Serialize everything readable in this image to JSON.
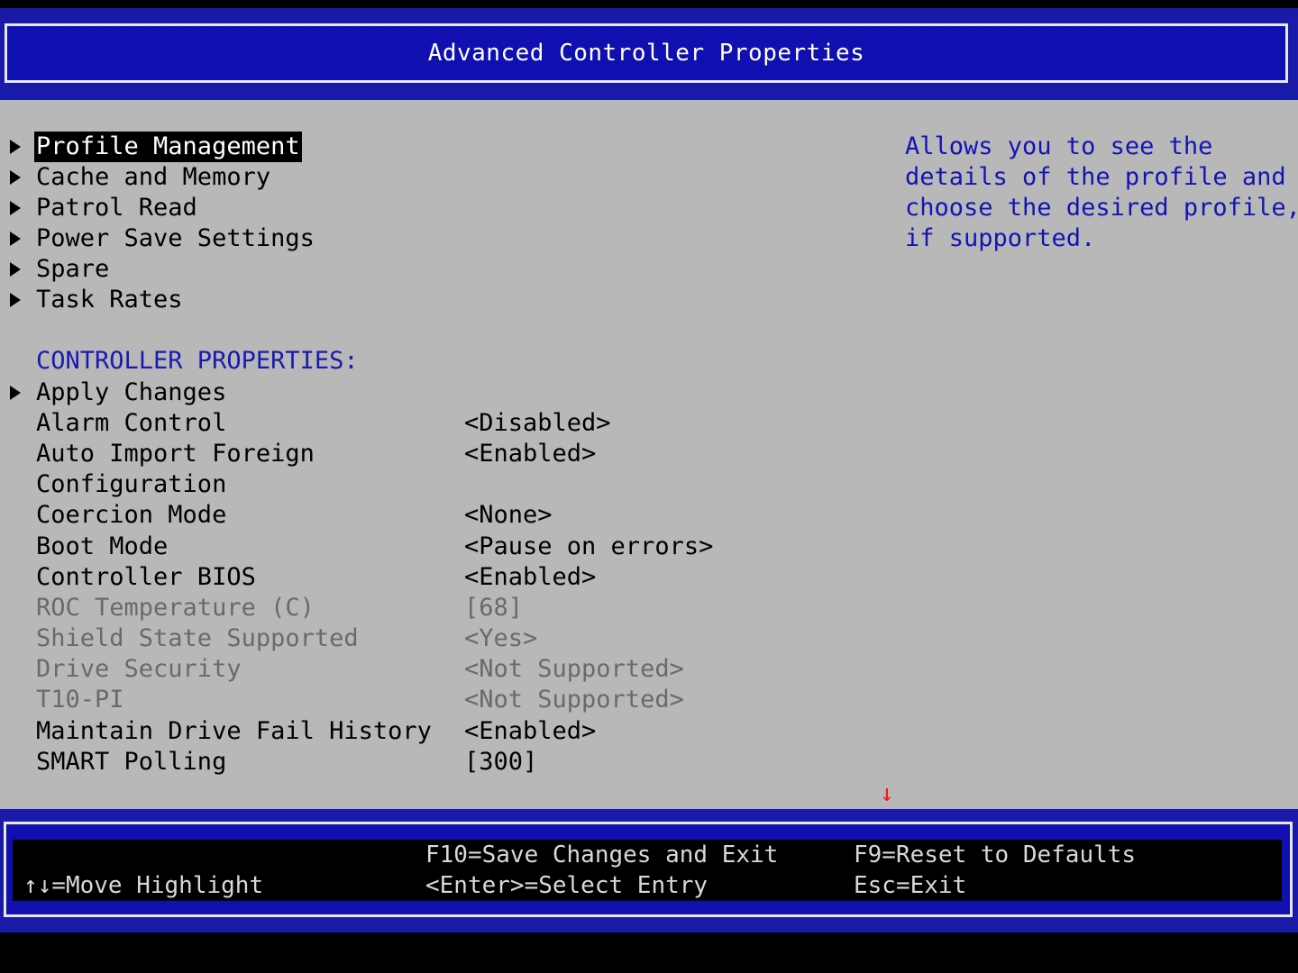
{
  "header": {
    "title": "Advanced Controller Properties"
  },
  "menu": {
    "items": [
      {
        "label": "Profile Management",
        "selected": true
      },
      {
        "label": "Cache and Memory"
      },
      {
        "label": "Patrol Read"
      },
      {
        "label": "Power Save Settings"
      },
      {
        "label": "Spare"
      },
      {
        "label": "Task Rates"
      }
    ]
  },
  "section": {
    "title": "CONTROLLER PROPERTIES:"
  },
  "properties": {
    "apply_changes": {
      "label": "Apply Changes"
    },
    "alarm_control": {
      "label": "Alarm Control",
      "value": "<Disabled>"
    },
    "auto_import_line1": {
      "label": "Auto Import Foreign",
      "value": "<Enabled>"
    },
    "auto_import_line2": {
      "label": "Configuration"
    },
    "coercion_mode": {
      "label": "Coercion Mode",
      "value": "<None>"
    },
    "boot_mode": {
      "label": "Boot Mode",
      "value": "<Pause on errors>"
    },
    "controller_bios": {
      "label": "Controller BIOS",
      "value": "<Enabled>"
    },
    "roc_temperature": {
      "label": "ROC Temperature (C)",
      "value": "[68]"
    },
    "shield_state": {
      "label": "Shield State Supported",
      "value": "<Yes>"
    },
    "drive_security": {
      "label": "Drive Security",
      "value": "<Not Supported>"
    },
    "t10_pi": {
      "label": "T10-PI",
      "value": "<Not Supported>"
    },
    "maintain_drive_fail": {
      "label": "Maintain Drive Fail History",
      "value": "<Enabled>"
    },
    "smart_polling": {
      "label": "SMART Polling",
      "value": "[300]"
    }
  },
  "help": {
    "lines": [
      "Allows you to see the",
      "details of the profile and",
      "choose the desired profile,",
      "if supported."
    ]
  },
  "scroll_indicator": "↓",
  "footer": {
    "move_highlight": "↑↓=Move Highlight",
    "save_exit": "F10=Save Changes and Exit",
    "select_entry": "<Enter>=Select Entry",
    "reset_defaults": "F9=Reset to Defaults",
    "esc_exit": "Esc=Exit"
  },
  "colors": {
    "header_blue": "#1010b0",
    "main_gray": "#b8b8b8",
    "section_blue": "#1a1ab0",
    "dim_text": "#6a6a6a",
    "scroll_arrow_red": "#ff1010"
  }
}
